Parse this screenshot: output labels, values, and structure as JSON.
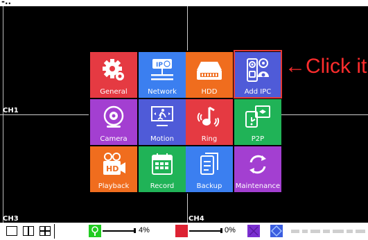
{
  "header": {
    "partial_label": "-.."
  },
  "channels": {
    "ch1": "CH1",
    "ch3": "CH3",
    "ch4": "CH4"
  },
  "menu": {
    "tiles": [
      {
        "label": "General",
        "color": "#e53a42",
        "icon": "gear-icon"
      },
      {
        "label": "Network",
        "color": "#3b7ff0",
        "icon": "network-icon"
      },
      {
        "label": "HDD",
        "color": "#f06d1e",
        "icon": "hdd-icon"
      },
      {
        "label": "Add IPC",
        "color": "#4f5bd8",
        "icon": "add-ipc-icon"
      },
      {
        "label": "Camera",
        "color": "#a33fd1",
        "icon": "camera-icon"
      },
      {
        "label": "Motion",
        "color": "#4f5bd8",
        "icon": "motion-icon"
      },
      {
        "label": "Ring",
        "color": "#e53a42",
        "icon": "ring-icon"
      },
      {
        "label": "P2P",
        "color": "#20b357",
        "icon": "p2p-icon"
      },
      {
        "label": "Playback",
        "color": "#f06d1e",
        "icon": "playback-icon"
      },
      {
        "label": "Record",
        "color": "#20b357",
        "icon": "record-icon"
      },
      {
        "label": "Backup",
        "color": "#3b7ff0",
        "icon": "backup-icon"
      },
      {
        "label": "Maintenance",
        "color": "#a33fd1",
        "icon": "maintenance-icon"
      }
    ]
  },
  "annotation": {
    "text": "←Click it",
    "color": "#ff2d2d"
  },
  "statusbar": {
    "volume1": {
      "percent_label": "4%",
      "level": 0.04,
      "color": "#22cc22"
    },
    "volume2": {
      "percent_label": "0%",
      "level": 0.0,
      "color": "#dd2233"
    },
    "colors": {
      "purple": "#7a2fd0",
      "blue": "#3a5de0"
    }
  }
}
